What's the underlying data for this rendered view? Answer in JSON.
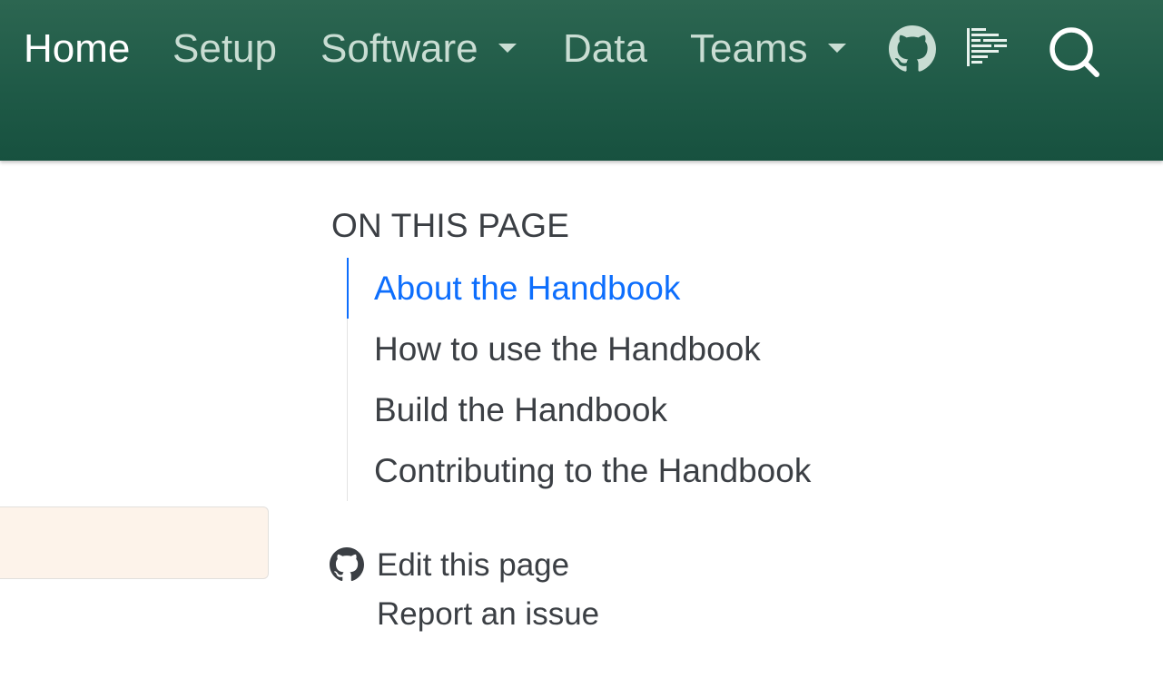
{
  "navbar": {
    "items": [
      {
        "label": "Home",
        "active": true
      },
      {
        "label": "Setup"
      },
      {
        "label": "Software",
        "dropdown": true
      },
      {
        "label": "Data"
      },
      {
        "label": "Teams",
        "dropdown": true
      }
    ],
    "icons": [
      "github-icon",
      "docs-list-icon",
      "search-icon"
    ],
    "colors": {
      "background": "#1f5a47",
      "text": "#c9ddd3",
      "active_text": "#ffffff"
    }
  },
  "toc": {
    "title": "ON THIS PAGE",
    "items": [
      {
        "label": "About the Handbook",
        "active": true
      },
      {
        "label": "How to use the Handbook"
      },
      {
        "label": "Build the Handbook"
      },
      {
        "label": "Contributing to the Handbook"
      }
    ],
    "active_color": "#0d6efd"
  },
  "page_links": {
    "edit": "Edit this page",
    "report": "Report an issue",
    "edit_icon": "github-icon"
  }
}
